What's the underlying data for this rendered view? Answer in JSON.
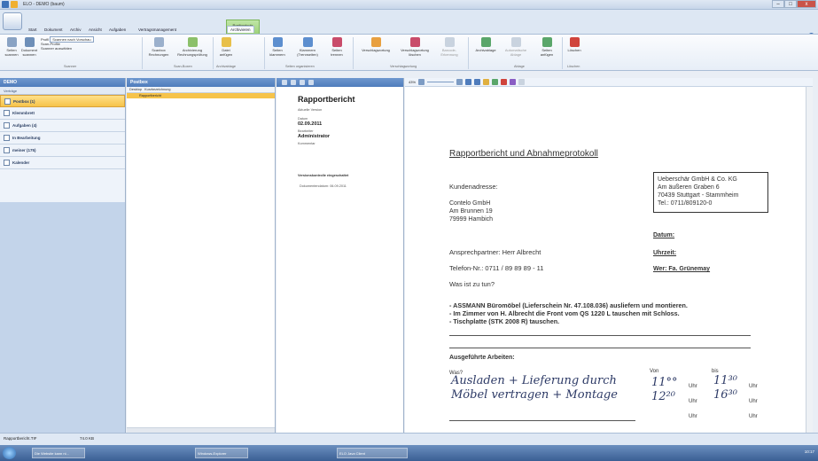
{
  "window": {
    "title": "ELO - DEMO (baum)",
    "min": "–",
    "max": "□",
    "close": "x"
  },
  "tabs": [
    "Start",
    "Dokument",
    "Archiv",
    "Ansicht",
    "Aufgaben",
    "Vertragsmanagement",
    "Archivieren"
  ],
  "context_tab": "Postboxtools",
  "ribbon": {
    "scanner": {
      "b1": "Seiten scannen",
      "b2": "Dokument scannen",
      "p1": "Profil",
      "p1v": "Scannen nach Vorschau",
      "p2": "Scan-Profile",
      "p3": "Scanner auswählen",
      "group": "Scanner"
    },
    "scanbox": {
      "b1": "Scanbox Rechnungen",
      "b2": "Archivierung Rechnungsprüfung",
      "group": "Scan-Boxen"
    },
    "archiv": {
      "b1": "Datei anfügen",
      "group": "Archivablage"
    },
    "ablage": {
      "b1": "Seiten klammern",
      "b2": "Klammern (Trennseiten)",
      "b3": "Seiten trennen",
      "group": "Seiten organisieren"
    },
    "versch": {
      "b1": "Verschlagwortung",
      "b2": "Verschlagwortung löschen",
      "b3": "Barcode-Erkennung",
      "group": "Verschlagwortung"
    },
    "ablage2": {
      "b1": "Archivablage",
      "b2": "Automatische Ablage",
      "b3": "Seiten anfügen",
      "b4": "Löschen",
      "g1": "Ablage",
      "g2": "Löschen"
    }
  },
  "nav": {
    "header": "DEMO",
    "sub": "Verträge",
    "items": [
      "Postbox (1)",
      "Klemmbrett",
      "Aufgaben (4)",
      "In Bearbeitung",
      "meiner (175)",
      "Kalender"
    ]
  },
  "list": {
    "header": "Postbox",
    "col1": "Desktop",
    "col2": "Kurzbezeichnung",
    "row": "Rapportbericht"
  },
  "info": {
    "title": "Rapportbericht",
    "version": "Aktuelle Version",
    "date_label": "Datum",
    "date": "02.09.2011",
    "editor_label": "Bearbeiter",
    "editor": "Administrator",
    "comment_label": "Kommentar",
    "vc": "Versionskontrolle eingeschaltet",
    "docdate": "Dokumentendatum: 06.09.2011"
  },
  "doc": {
    "zoom": "43%",
    "heading": "Rapportbericht und Abnahmeprotokoll",
    "kunde_label": "Kundenadresse:",
    "kunde": [
      "Contelo GmbH",
      "Am Brunnen 19",
      "79999 Hambich"
    ],
    "firm": [
      "Ueberschär GmbH & Co. KG",
      "Am äußeren Graben 6",
      "70439 Stuttgart - Stammheim",
      "Tel.: 0711/809120-0"
    ],
    "datum": "Datum:",
    "uhrzeit": "Uhrzeit:",
    "wer": "Wer: Fa. Grünemay",
    "ansprech": "Ansprechpartner:  Herr Albrecht",
    "tel": "Telefon-Nr.:        0711 / 89 89 89 - 11",
    "was": "Was ist zu tun?",
    "todo": [
      "- ASSMANN Büromöbel (Lieferschein Nr. 47.108.036) ausliefern und montieren.",
      "- Im Zimmer von H. Albrecht die Front vom QS 1220 L tauschen mit Schloss.",
      "- Tischplatte (STK 2008 R) tauschen."
    ],
    "ausg": "Ausgeführte Arbeiten:",
    "was2": "Was?",
    "von": "Von",
    "bis": "bis",
    "hw1": "Ausladen + Lieferung durch",
    "hw2": "Möbel vertragen + Montage",
    "t1": "11°°",
    "t2": "11³⁰",
    "t3": "12²⁰",
    "t4": "16³⁰",
    "uhr": "Uhr"
  },
  "status": {
    "file": "Rapportbericht.TIF",
    "size": "74.0 KB"
  },
  "taskbar": [
    "Die Website kann ni...",
    "Windows-Explorer",
    "ELO Java Client"
  ],
  "clock": "10:17"
}
